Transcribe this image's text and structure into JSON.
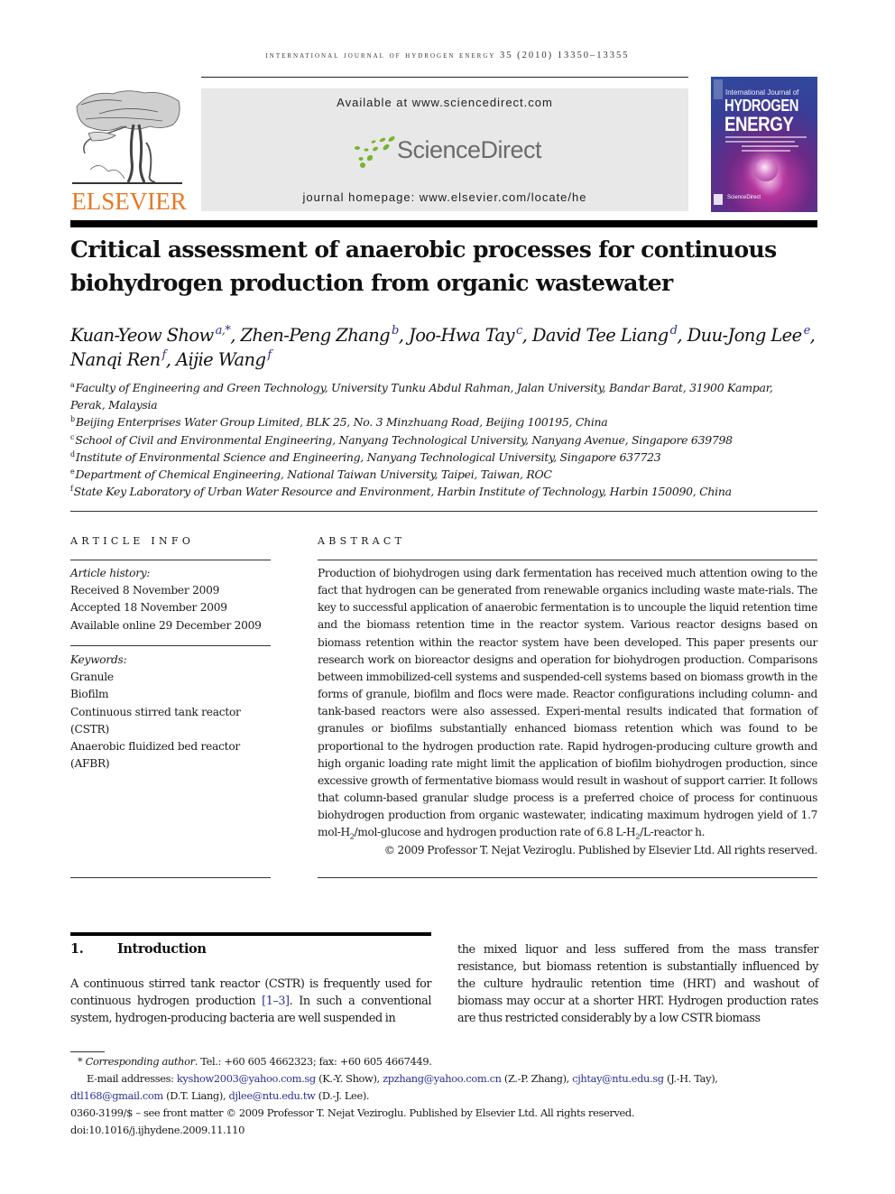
{
  "header": {
    "running_head": "INTERNATIONAL JOURNAL OF HYDROGEN ENERGY 35 (2010) 13350–13355",
    "publisher_logo_text": "ELSEVIER",
    "available_at": "Available at www.sciencedirect.com",
    "sciencedirect_logo_text": "ScienceDirect",
    "journal_homepage": "journal homepage: www.elsevier.com/locate/he",
    "cover": {
      "line1": "International Journal of",
      "line2": "HYDROGEN",
      "line3": "ENERGY",
      "footer": "ScienceDirect"
    }
  },
  "article": {
    "title": "Critical assessment of anaerobic processes for continuous biohydrogen production from organic wastewater",
    "authors": [
      {
        "name": "Kuan-Yeow Show",
        "sup": "a,*",
        "sep": ", "
      },
      {
        "name": "Zhen-Peng Zhang",
        "sup": "b",
        "sep": ", "
      },
      {
        "name": "Joo-Hwa Tay",
        "sup": "c",
        "sep": ", "
      },
      {
        "name": "David Tee Liang",
        "sup": "d",
        "sep": ", "
      },
      {
        "name": "Duu-Jong Lee",
        "sup": "e",
        "sep": ","
      },
      {
        "name": "Nanqi Ren",
        "sup": "f",
        "sep": ", "
      },
      {
        "name": "Aijie Wang",
        "sup": "f",
        "sep": ""
      }
    ],
    "affiliations": [
      {
        "key": "a",
        "text": "Faculty of Engineering and Green Technology, University Tunku Abdul Rahman, Jalan University, Bandar Barat, 31900 Kampar, Perak, Malaysia"
      },
      {
        "key": "b",
        "text": "Beijing Enterprises Water Group Limited, BLK 25, No. 3 Minzhuang Road, Beijing 100195, China"
      },
      {
        "key": "c",
        "text": "School of Civil and Environmental Engineering, Nanyang Technological University, Nanyang Avenue, Singapore 639798"
      },
      {
        "key": "d",
        "text": "Institute of Environmental Science and Engineering, Nanyang Technological University, Singapore 637723"
      },
      {
        "key": "e",
        "text": "Department of Chemical Engineering, National Taiwan University, Taipei, Taiwan, ROC"
      },
      {
        "key": "f",
        "text": "State Key Laboratory of Urban Water Resource and Environment, Harbin Institute of Technology, Harbin 150090, China"
      }
    ]
  },
  "article_info": {
    "heading": "ARTICLE INFO",
    "history_label": "Article history:",
    "received": "Received 8 November 2009",
    "accepted": "Accepted 18 November 2009",
    "available_online": "Available online 29 December 2009",
    "keywords_label": "Keywords:",
    "keywords": [
      "Granule",
      "Biofilm",
      "Continuous stirred tank reactor",
      "(CSTR)",
      "Anaerobic fluidized bed reactor",
      "(AFBR)"
    ]
  },
  "abstract": {
    "heading": "ABSTRACT",
    "text_part1": "Production of biohydrogen using dark fermentation has received much attention owing to the fact that hydrogen can be generated from renewable organics including waste mate-rials. The key to successful application of anaerobic fermentation is to uncouple the liquid retention time and the biomass retention time in the reactor system. Various reactor designs based on biomass retention within the reactor system have been developed. This paper presents our research work on bioreactor designs and operation for biohydrogen production. Comparisons between immobilized-cell systems and suspended-cell systems based on biomass growth in the forms of granule, biofilm and flocs were made. Reactor configurations including column- and tank-based reactors were also assessed. Experi-mental results indicated that formation of granules or biofilms substantially enhanced biomass retention which was found to be proportional to the hydrogen production rate. Rapid hydrogen-producing culture growth and high organic loading rate might limit the application of biofilm biohydrogen production, since excessive growth of fermentative biomass would result in washout of support carrier. It follows that column-based granular sludge process is a preferred choice of process for continuous biohydrogen production from organic wastewater, indicating maximum hydrogen yield of 1.7 mol-H",
    "sub1": "2",
    "text_part2": "/mol-glucose and hydrogen production rate of 6.8 L-H",
    "sub2": "2",
    "text_part3": "/L-reactor h.",
    "copyright": "© 2009 Professor T. Nejat Veziroglu. Published by Elsevier Ltd. All rights reserved."
  },
  "introduction": {
    "number": "1.",
    "heading": "Introduction",
    "left_text_before_cite": "A continuous stirred tank reactor (CSTR) is frequently used for continuous hydrogen production ",
    "citation": "[1–3]",
    "left_text_after_cite": ". In such a conventional system, hydrogen-producing bacteria are well suspended in",
    "right_text": "the mixed liquor and less suffered from the mass transfer resistance, but biomass retention is substantially influenced by the culture hydraulic retention time (HRT) and washout of biomass may occur at a shorter HRT. Hydrogen production rates are thus restricted considerably by a low CSTR biomass"
  },
  "footnotes": {
    "corresponding_star": "*",
    "corresponding_label": "Corresponding author",
    "corresponding_contact": ". Tel.: +60 605 4662323; fax: +60 605 4667449.",
    "email_label": "E-mail addresses: ",
    "emails": [
      {
        "address": "kyshow2003@yahoo.com.sg",
        "who": " (K.-Y. Show), "
      },
      {
        "address": "zpzhang@yahoo.com.cn",
        "who": " (Z.-P. Zhang), "
      },
      {
        "address": "cjhtay@ntu.edu.sg",
        "who": " (J.-H. Tay), "
      },
      {
        "address": "dtl168@gmail.com",
        "who": " (D.T. Liang), "
      },
      {
        "address": "djlee@ntu.edu.tw",
        "who": " (D.-J. Lee)."
      }
    ],
    "front_matter": "0360-3199/$ – see front matter © 2009 Professor T. Nejat Veziroglu. Published by Elsevier Ltd. All rights reserved.",
    "doi": "doi:10.1016/j.ijhydene.2009.11.110"
  },
  "colors": {
    "elsevier_orange": "#e87722",
    "sciencedirect_green": "#7ab32e",
    "link_blue": "#2b2f8f",
    "header_box_gray": "#e8e8e8"
  }
}
